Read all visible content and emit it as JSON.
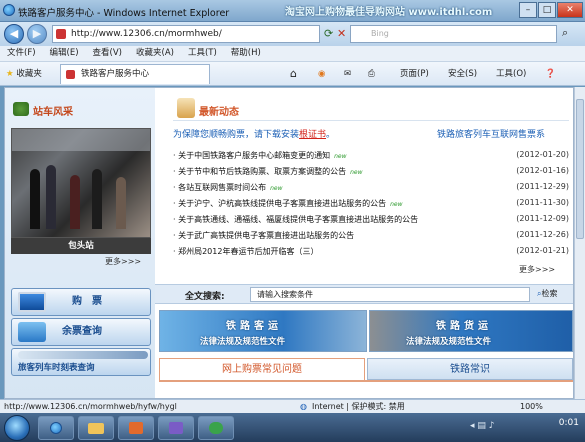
{
  "window": {
    "title": "铁路客户服务中心 - Windows Internet Explorer",
    "watermark": "淘宝网上购物最佳导购网站 www.itdhl.com",
    "controls": [
      "–",
      "□",
      "✕"
    ]
  },
  "address_bar": {
    "url": "http://www.12306.cn/mormhweb/",
    "search_provider": "Bing"
  },
  "menu": [
    "文件(F)",
    "编辑(E)",
    "查看(V)",
    "收藏夹(A)",
    "工具(T)",
    "帮助(H)"
  ],
  "favorites_bar": {
    "favorites_label": "收藏夹",
    "tab_label": "铁路客户服务中心",
    "commands": [
      "页面(P)",
      "安全(S)",
      "工具(O)"
    ]
  },
  "left": {
    "station_header": "站车风采",
    "photo_caption": "包头站",
    "photo_dots": "1 2 3 4 5",
    "more": "更多>>>",
    "buttons": [
      "购　票",
      "余票查询",
      "旅客列车时刻表查询"
    ]
  },
  "news": {
    "header": "最新动态",
    "notice_prefix": "为保障您顺畅购票，请下载安装",
    "notice_link": "根证书",
    "notice_suffix": "。",
    "right_link": "铁路旅客列车互联网售票系",
    "new_tag": "new",
    "items": [
      {
        "title": "关于中国铁路客户服务中心邮箱变更的通知",
        "date": "(2012-01-20)",
        "new": true
      },
      {
        "title": "关于节中和节后铁路购票、取票方案调整的公告",
        "date": "(2012-01-16)",
        "new": true
      },
      {
        "title": "各站互联网售票时间公布",
        "date": "(2011-12-29)",
        "new": true
      },
      {
        "title": "关于沪宁、沪杭高铁线提供电子客票直接进出站服务的公告",
        "date": "(2011-11-30)",
        "new": true
      },
      {
        "title": "关于高铁通线、通福线、福厦线提供电子客票直接进出站服务的公告",
        "date": "(2011-12-09)",
        "new": false
      },
      {
        "title": "关于武广高铁提供电子客票直接进出站服务的公告",
        "date": "(2011-12-26)",
        "new": false
      },
      {
        "title": "郑州局2012年春运节后加开临客（三）",
        "date": "(2012-01-21)",
        "new": false
      }
    ],
    "more": "更多>>>"
  },
  "search": {
    "label": "全文搜索:",
    "placeholder": "请输入搜索条件",
    "button": "检索"
  },
  "banners": [
    {
      "title": "铁路客运",
      "subtitle": "法律法规及规范性文件"
    },
    {
      "title": "铁路货运",
      "subtitle": "法律法规及规范性文件"
    }
  ],
  "bottom_tabs": [
    "网上购票常见问题",
    "铁路常识"
  ],
  "status_bar": {
    "url": "http://www.12306.cn/mormhweb/hyfw/hygl",
    "zone": "Internet | 保护模式: 禁用",
    "zoom": "100%"
  },
  "taskbar": {
    "clock": "0:01"
  }
}
